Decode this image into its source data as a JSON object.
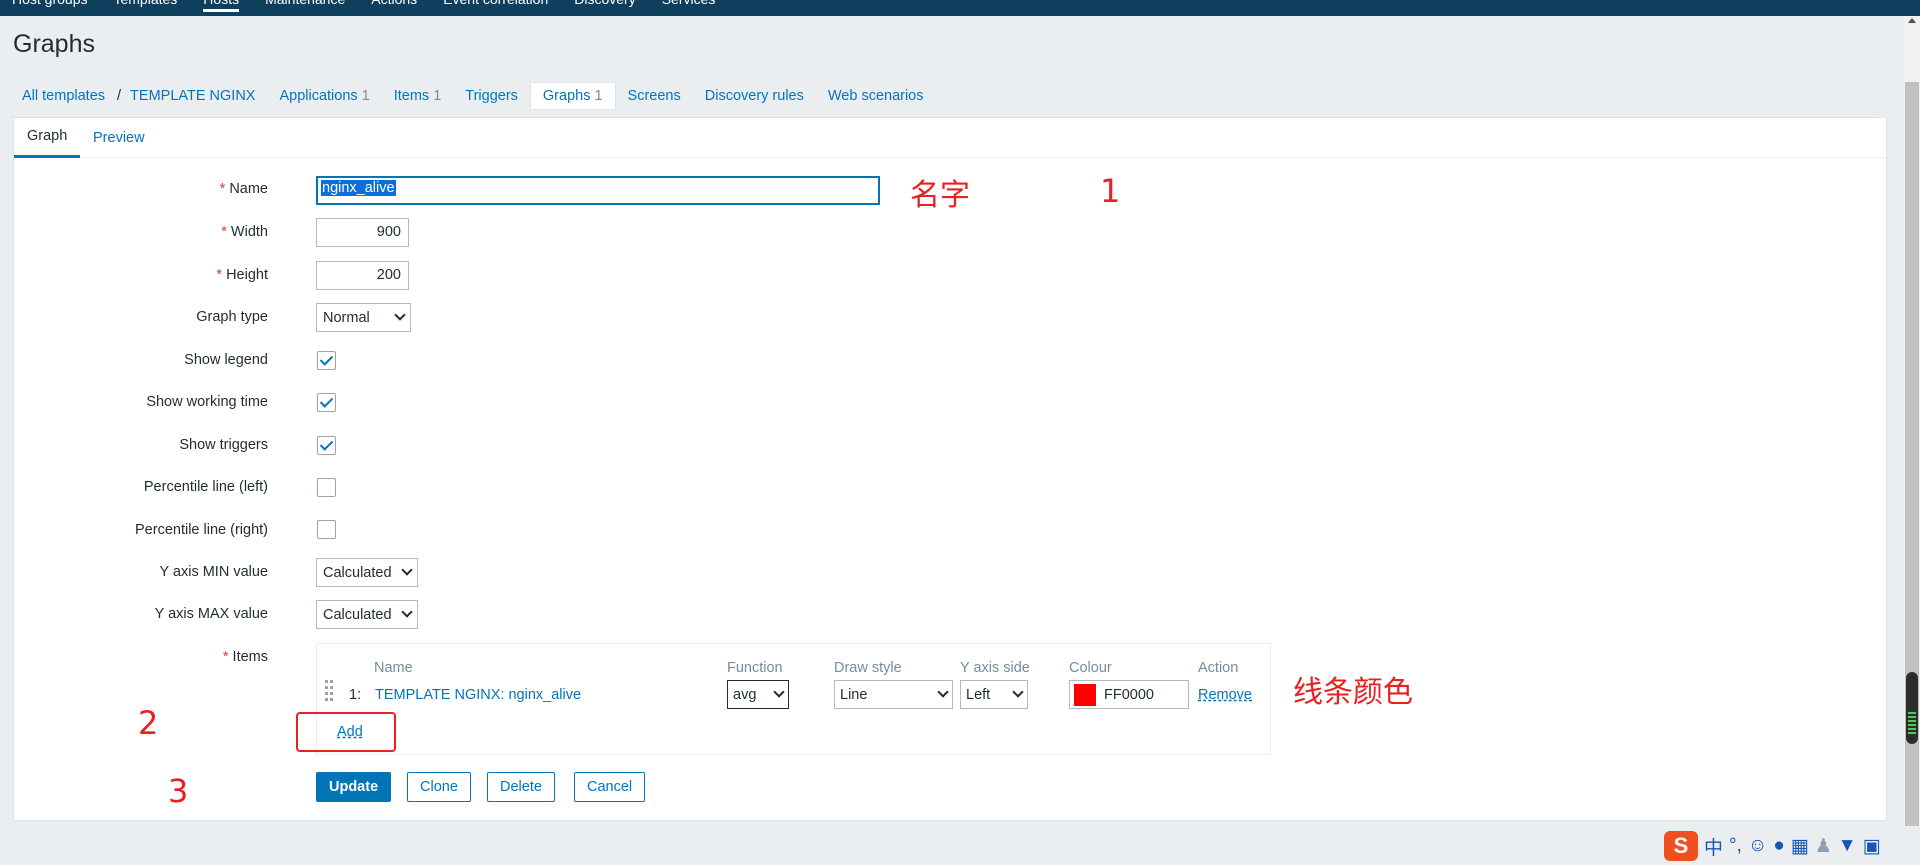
{
  "topnav": {
    "items": [
      "Host groups",
      "Templates",
      "Hosts",
      "Maintenance",
      "Actions",
      "Event correlation",
      "Discovery",
      "Services"
    ],
    "active_index": 2
  },
  "page": {
    "title": "Graphs"
  },
  "breadcrumbs": {
    "all_templates": "All templates",
    "separator": "/",
    "template": "TEMPLATE NGINX",
    "tabs": [
      {
        "label": "Applications",
        "count": "1"
      },
      {
        "label": "Items",
        "count": "1"
      },
      {
        "label": "Triggers",
        "count": ""
      },
      {
        "label": "Graphs",
        "count": "1"
      },
      {
        "label": "Screens",
        "count": ""
      },
      {
        "label": "Discovery rules",
        "count": ""
      },
      {
        "label": "Web scenarios",
        "count": ""
      }
    ]
  },
  "form_tabs": {
    "graph": "Graph",
    "preview": "Preview"
  },
  "form": {
    "name_label": "Name",
    "name_value": "nginx_alive",
    "width_label": "Width",
    "width_value": "900",
    "height_label": "Height",
    "height_value": "200",
    "graph_type_label": "Graph type",
    "graph_type_value": "Normal",
    "show_legend_label": "Show legend",
    "show_legend": true,
    "show_working_time_label": "Show working time",
    "show_working_time": true,
    "show_triggers_label": "Show triggers",
    "show_triggers": true,
    "percentile_left_label": "Percentile line (left)",
    "percentile_left": false,
    "percentile_right_label": "Percentile line (right)",
    "percentile_right": false,
    "ymin_label": "Y axis MIN value",
    "ymin_value": "Calculated",
    "ymax_label": "Y axis MAX value",
    "ymax_value": "Calculated",
    "items_label": "Items",
    "required_mark": "*"
  },
  "items_table": {
    "headers": {
      "name": "Name",
      "function": "Function",
      "draw_style": "Draw style",
      "y_axis_side": "Y axis side",
      "colour": "Colour",
      "action": "Action"
    },
    "rows": [
      {
        "num": "1:",
        "name": "TEMPLATE NGINX: nginx_alive",
        "function": "avg",
        "draw_style": "Line",
        "y_axis_side": "Left",
        "colour": "FF0000",
        "colour_hex": "#FF0000",
        "action": "Remove"
      }
    ],
    "add_label": "Add"
  },
  "buttons": {
    "update": "Update",
    "clone": "Clone",
    "delete": "Delete",
    "cancel": "Cancel"
  },
  "annotations": {
    "name_note": "名字",
    "one": "1",
    "line_colour_note": "线条颜色",
    "two": "2",
    "three": "3"
  },
  "tray": {
    "ime_logo": "S",
    "chinese_mode": "中",
    "punct": "°,",
    "icons": [
      "emoji-icon",
      "microphone-icon",
      "keyboard-icon",
      "user-icon",
      "shirt-icon",
      "grid-icon"
    ]
  },
  "colors": {
    "accent": "#0275b8",
    "nav": "#0e3f5c",
    "annotation": "#e8201f",
    "required": "#e33734"
  }
}
